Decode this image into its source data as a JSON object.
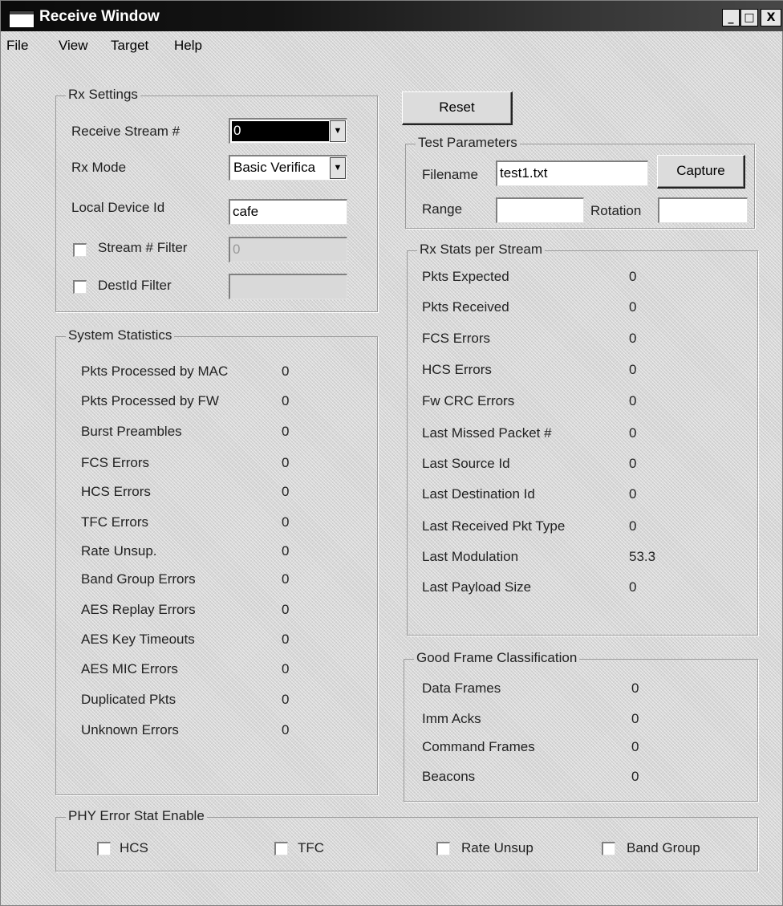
{
  "window": {
    "title": "Receive Window",
    "minimize": "_",
    "maximize": "□",
    "close": "X"
  },
  "menu": [
    "File",
    "View",
    "Target",
    "Help"
  ],
  "rx_settings": {
    "legend": "Rx Settings",
    "receive_stream_label": "Receive Stream #",
    "receive_stream_value": "0",
    "rx_mode_label": "Rx Mode",
    "rx_mode_value": "Basic Verifica",
    "local_device_label": "Local Device Id",
    "local_device_value": "cafe",
    "stream_filter_label": "Stream # Filter",
    "stream_filter_value": "0",
    "destid_filter_label": "DestId Filter",
    "destid_filter_value": ""
  },
  "system_stats": {
    "legend": "System Statistics",
    "rows": [
      {
        "label": "Pkts Processed by MAC",
        "value": "0"
      },
      {
        "label": "Pkts Processed by FW",
        "value": "0"
      },
      {
        "label": "Burst Preambles",
        "value": "0"
      },
      {
        "label": "FCS Errors",
        "value": "0"
      },
      {
        "label": "HCS Errors",
        "value": "0"
      },
      {
        "label": "TFC Errors",
        "value": "0"
      },
      {
        "label": "Rate Unsup.",
        "value": "0"
      },
      {
        "label": "Band Group Errors",
        "value": "0"
      },
      {
        "label": "AES Replay Errors",
        "value": "0"
      },
      {
        "label": "AES Key Timeouts",
        "value": "0"
      },
      {
        "label": "AES MIC Errors",
        "value": "0"
      },
      {
        "label": "Duplicated Pkts",
        "value": "0"
      },
      {
        "label": "Unknown Errors",
        "value": "0"
      }
    ]
  },
  "reset_button": "Reset",
  "test_params": {
    "legend": "Test Parameters",
    "filename_label": "Filename",
    "filename_value": "test1.txt",
    "capture_button": "Capture",
    "range_label": "Range",
    "range_value": "",
    "rotation_label": "Rotation",
    "rotation_value": ""
  },
  "rx_stats": {
    "legend": "Rx Stats per Stream",
    "rows": [
      {
        "label": "Pkts Expected",
        "value": "0"
      },
      {
        "label": "Pkts Received",
        "value": "0"
      },
      {
        "label": "FCS Errors",
        "value": "0"
      },
      {
        "label": "HCS Errors",
        "value": "0"
      },
      {
        "label": "Fw CRC Errors",
        "value": "0"
      },
      {
        "label": "Last Missed Packet #",
        "value": "0"
      },
      {
        "label": "Last Source Id",
        "value": "0"
      },
      {
        "label": "Last Destination Id",
        "value": "0"
      },
      {
        "label": "Last Received Pkt Type",
        "value": "0"
      },
      {
        "label": "Last Modulation",
        "value": "53.3"
      },
      {
        "label": "Last Payload Size",
        "value": "0"
      }
    ]
  },
  "good_frames": {
    "legend": "Good Frame Classification",
    "rows": [
      {
        "label": "Data Frames",
        "value": "0"
      },
      {
        "label": "Imm Acks",
        "value": "0"
      },
      {
        "label": "Command Frames",
        "value": "0"
      },
      {
        "label": "Beacons",
        "value": "0"
      }
    ]
  },
  "phy_error": {
    "legend": "PHY Error Stat Enable",
    "checks": [
      "HCS",
      "TFC",
      "Rate Unsup",
      "Band Group"
    ]
  }
}
